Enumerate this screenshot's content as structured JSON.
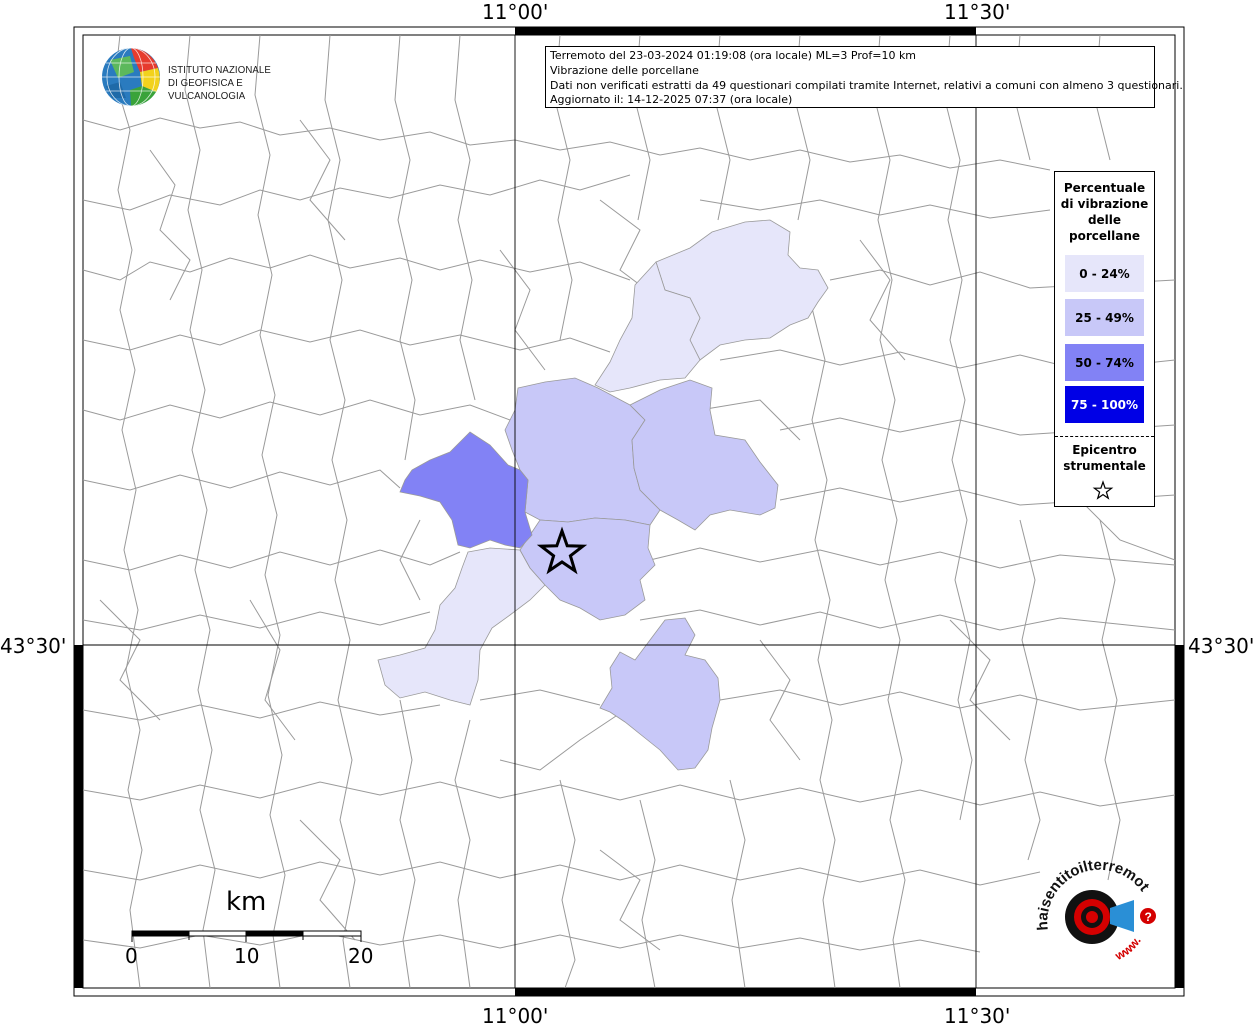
{
  "coordinates": {
    "top_left": "11°00'",
    "top_right": "11°30'",
    "bottom_left": "11°00'",
    "bottom_right": "11°30'",
    "left": "43°30'",
    "right": "43°30'"
  },
  "logo": {
    "line1": "ISTITUTO NAZIONALE",
    "line2": "DI GEOFISICA E VULCANOLOGIA"
  },
  "info": {
    "line1": "Terremoto del 23-03-2024 01:19:08 (ora locale) ML=3 Prof=10 km",
    "line2": "Vibrazione delle porcellane",
    "line3": "Dati non verificati estratti da 49 questionari compilati tramite Internet, relativi a comuni con almeno 3 questionari.",
    "line4": "Aggiornato il: 14-12-2025 07:37 (ora locale)"
  },
  "legend": {
    "title1": "Percentuale",
    "title2": "di vibrazione",
    "title3": "delle",
    "title4": "porcellane",
    "classes": [
      {
        "label": "0 - 24%",
        "color": "#e6e6fa"
      },
      {
        "label": "25 - 49%",
        "color": "#c8c8f8"
      },
      {
        "label": "50 - 74%",
        "color": "#8282f5"
      },
      {
        "label": "75 - 100%",
        "color": "#0000e6"
      }
    ],
    "epicenter1": "Epicentro",
    "epicenter2": "strumentale"
  },
  "scale": {
    "unit": "km",
    "ticks": [
      "0",
      "10",
      "20"
    ]
  },
  "brand": {
    "text": "haisentitoilterremoto.it",
    "prefix": "www."
  },
  "colors": {
    "class_0_24": "#e6e6fa",
    "class_25_49": "#c8c8f8",
    "class_50_74": "#8282f5",
    "class_75_100": "#0000e6",
    "boundaries": "#9a9a9a",
    "frame": "#000000"
  }
}
